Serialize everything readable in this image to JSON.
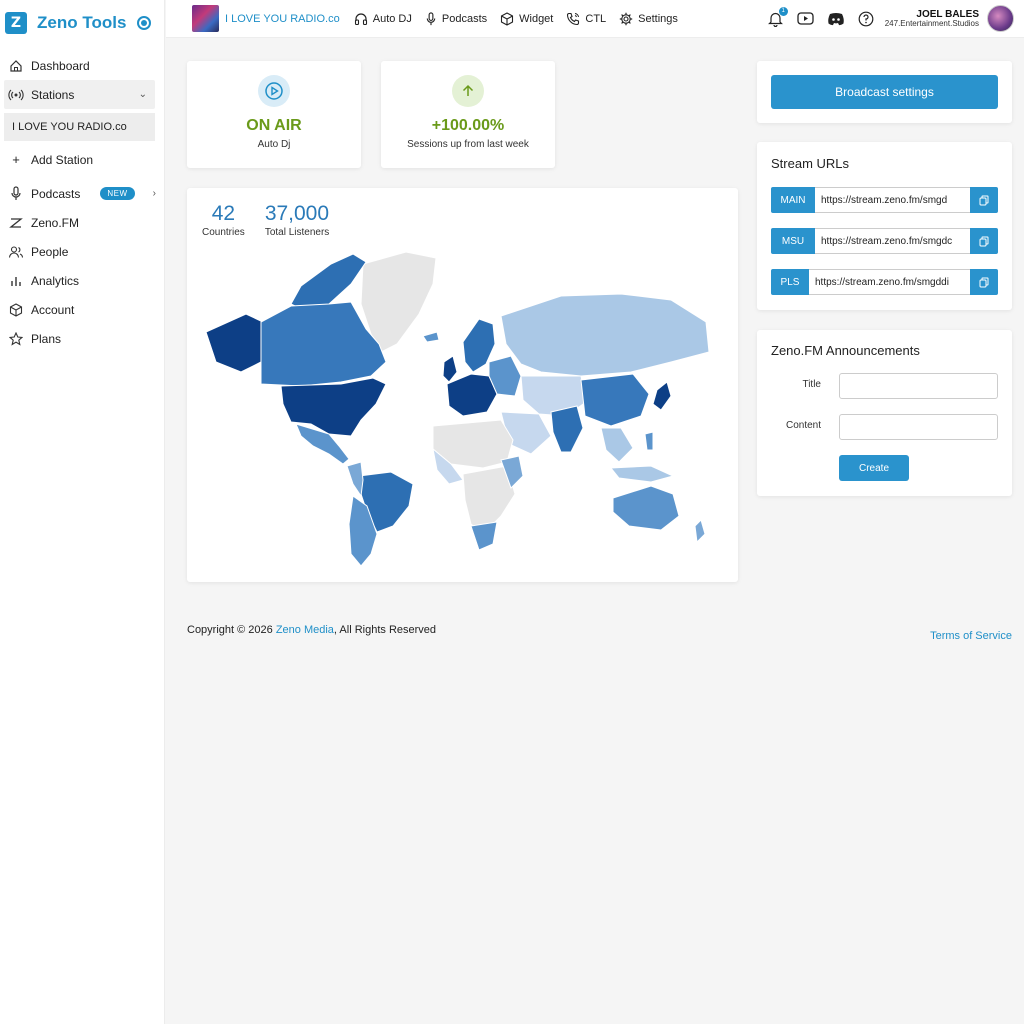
{
  "brand": {
    "name": "Zeno Tools",
    "logo": "Z"
  },
  "sidebar": {
    "items": [
      {
        "label": "Dashboard",
        "icon": "home-icon"
      },
      {
        "label": "Stations",
        "icon": "broadcast-icon"
      },
      {
        "label": "I LOVE YOU RADIO.co"
      },
      {
        "label": "Add Station",
        "icon": "plus-icon"
      },
      {
        "label": "Podcasts",
        "icon": "microphone-icon",
        "badge": "NEW"
      },
      {
        "label": "Zeno.FM",
        "icon": "zeno-icon"
      },
      {
        "label": "People",
        "icon": "people-icon"
      },
      {
        "label": "Analytics",
        "icon": "bar-chart-icon"
      },
      {
        "label": "Account",
        "icon": "cube-icon"
      },
      {
        "label": "Plans",
        "icon": "star-icon"
      }
    ]
  },
  "topbar": {
    "station": "I LOVE YOU RADIO.co",
    "links": [
      {
        "label": "Auto DJ",
        "icon": "headphones-icon"
      },
      {
        "label": "Podcasts",
        "icon": "microphone-icon"
      },
      {
        "label": "Widget",
        "icon": "cube-icon"
      },
      {
        "label": "CTL",
        "icon": "phone-icon"
      },
      {
        "label": "Settings",
        "icon": "gear-icon"
      }
    ],
    "notification_count": "1",
    "user_name": "JOEL BALES",
    "user_org": "247.Entertainment.Studios"
  },
  "stats": {
    "on_air": {
      "value": "ON AIR",
      "label": "Auto Dj"
    },
    "sessions": {
      "value": "+100.00%",
      "label": "Sessions up from last week"
    }
  },
  "map": {
    "countries": "42",
    "countries_label": "Countries",
    "listeners": "37,000",
    "listeners_label": "Total Listeners"
  },
  "broadcast": {
    "button": "Broadcast settings"
  },
  "stream_urls": {
    "title": "Stream URLs",
    "rows": [
      {
        "tag": "MAIN",
        "url": "https://stream.zeno.fm/smgd"
      },
      {
        "tag": "MSU",
        "url": "https://stream.zeno.fm/smgdc"
      },
      {
        "tag": "PLS",
        "url": "https://stream.zeno.fm/smgddi"
      }
    ]
  },
  "announcements": {
    "title": "Zeno.FM Announcements",
    "title_label": "Title",
    "content_label": "Content",
    "create": "Create"
  },
  "footer": {
    "copyright_prefix": "Copyright © 2026 ",
    "company": "Zeno Media",
    "copyright_suffix": ", All Rights Reserved",
    "terms": "Terms of Service"
  },
  "colors": {
    "accent": "#1f8fc8",
    "on_air": "#6a9a1a",
    "map_dark": "#0d3f86",
    "map_light": "#c6d8ee"
  }
}
